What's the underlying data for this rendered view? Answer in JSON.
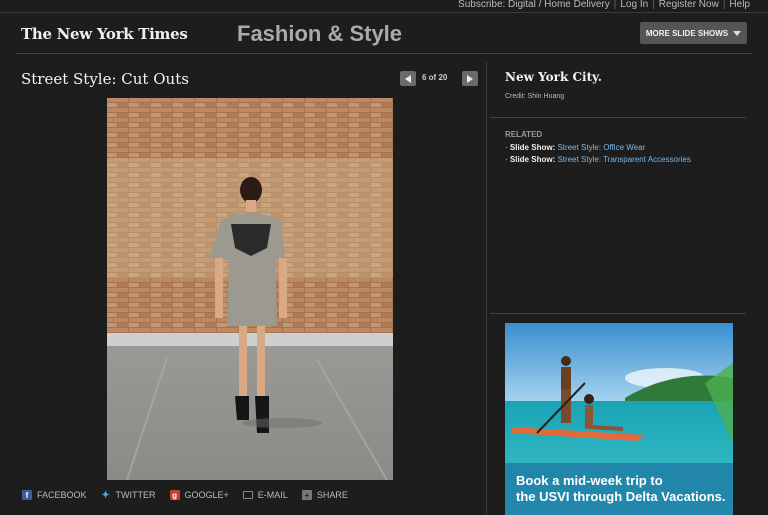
{
  "toplinks": [
    "Subscribe: Digital / Home Delivery",
    "Log In",
    "Register Now",
    "Help"
  ],
  "masthead": {
    "logo": "The New York Times",
    "section": "Fashion & Style",
    "more_slideshows": "MORE SLIDE SHOWS"
  },
  "slideshow": {
    "title": "Street Style: Cut Outs",
    "counter": "6 of 20"
  },
  "sidebar": {
    "caption_title": "New York City.",
    "credit": "Credit: Shin Huang",
    "related_label": "RELATED",
    "related": [
      {
        "prefix": "Slide Show:",
        "link": "Street Style: Office Wear"
      },
      {
        "prefix": "Slide Show:",
        "link": "Street Style: Transparent Accessories"
      }
    ]
  },
  "share": [
    "FACEBOOK",
    "TWITTER",
    "GOOGLE+",
    "E-MAIL",
    "SHARE"
  ],
  "ad": {
    "line1": "Book a mid-week trip to",
    "line2": "the USVI through Delta Vacations."
  }
}
